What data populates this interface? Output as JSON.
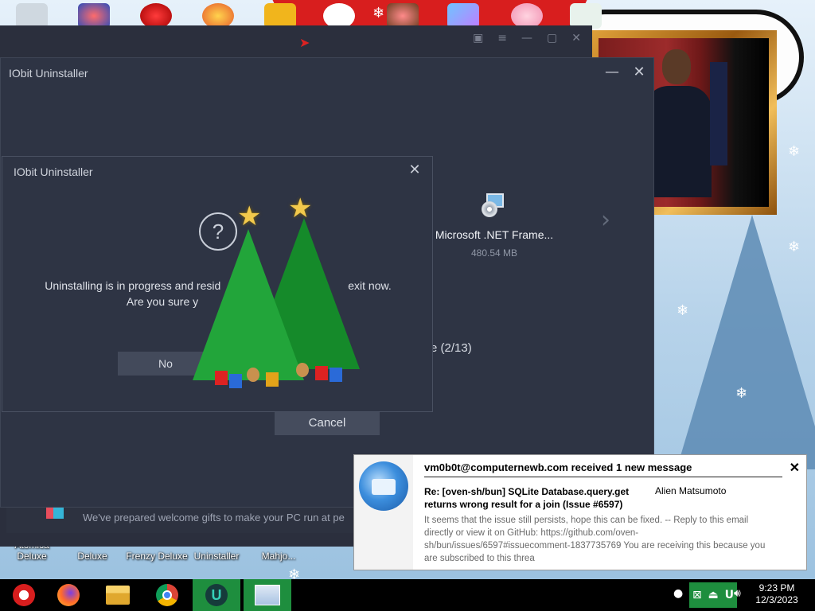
{
  "desktop": {
    "icon_labels": [
      {
        "line1": "Atomica",
        "line2": "Deluxe"
      },
      {
        "line1": "Deluxe",
        "line2": ""
      },
      {
        "line1": "Frenzy Deluxe",
        "line2": ""
      },
      {
        "line1": "Uninstaller",
        "line2": ""
      },
      {
        "line1": "Mahjo...",
        "line2": ""
      }
    ]
  },
  "back_window": {
    "promo_text": "We've prepared welcome gifts to make your PC run at pe"
  },
  "main_window": {
    "title": "IObit Uninstaller",
    "app_name": "Microsoft .NET Frame...",
    "app_size": "480.54 MB",
    "progress_text": "e (2/13)",
    "cancel_label": "Cancel"
  },
  "dialog": {
    "title": "IObit Uninstaller",
    "question_mark": "?",
    "message_line1": "Uninstalling is in progress and resid",
    "message_line1_tail": "exit now.",
    "message_line2": "Are you sure y",
    "no_label": "No"
  },
  "notification": {
    "header": "vm0b0t@computernewb.com received 1 new message",
    "subject": "Re: [oven-sh/bun] SQLite Database.query.get returns wrong result for a join (Issue #6597)",
    "sender": "Alien Matsumoto",
    "body": "It seems that the issue still persists, hope this can be fixed. -- Reply to this email directly or view it on GitHub: https://github.com/oven-sh/bun/issues/6597#issuecomment-1837735769 You are receiving this because you are subscribed to this threa",
    "close_glyph": "✕"
  },
  "taskbar": {
    "time": "9:23 PM",
    "date": "12/3/2023",
    "pinned": [
      "santa-start-icon",
      "firefox-icon",
      "file-explorer-icon",
      "chrome-icon",
      "iobit-uninstaller-icon",
      "control-panel-icon"
    ]
  },
  "colors": {
    "window_bg": "#2e3444",
    "taskbar_active": "#1e8e3e",
    "accent_red": "#d81e1e"
  }
}
